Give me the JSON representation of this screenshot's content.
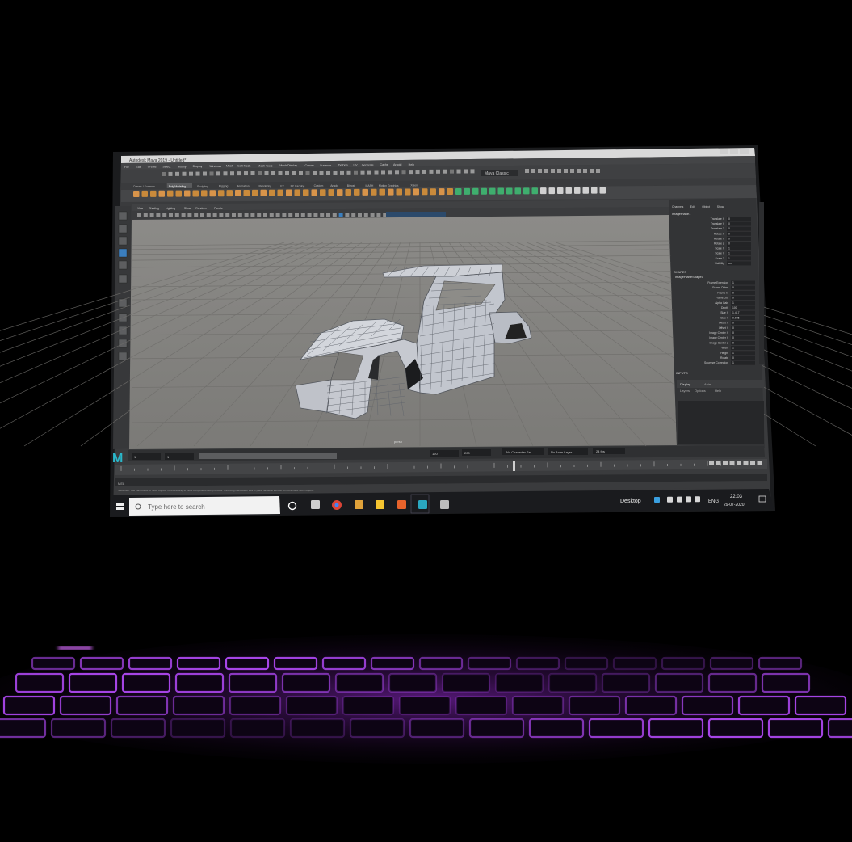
{
  "photo": {
    "description_subject": "laptop-screen-photo"
  },
  "maya": {
    "title": "Autodesk Maya 2019 - Untitled*",
    "menus": [
      "File",
      "Edit",
      "Create",
      "Select",
      "Modify",
      "Display",
      "Windows",
      "Mesh",
      "Edit Mesh",
      "Mesh Tools",
      "Mesh Display",
      "Curves",
      "Surfaces",
      "Deform",
      "UV",
      "Generate",
      "Cache",
      "Arnold",
      "Help"
    ],
    "workspace": "Maya Classic",
    "shelf_tabs": [
      "Curves / Surfaces",
      "Poly Modeling",
      "Sculpting",
      "Rigging",
      "Animation",
      "Rendering",
      "FX",
      "FX Caching",
      "Custom",
      "Arnold",
      "Bifrost",
      "MASH",
      "Motion Graphics",
      "XGen"
    ],
    "active_shelf_tab": "Poly Modeling",
    "panel_menus": [
      "View",
      "Shading",
      "Lighting",
      "Show",
      "Renderer",
      "Panels"
    ],
    "channel_box": {
      "header": [
        "Channels",
        "Edit",
        "Object",
        "Show"
      ],
      "object_name": "imagePlane1",
      "attrs": [
        {
          "name": "Translate X",
          "value": "0"
        },
        {
          "name": "Translate Y",
          "value": "0"
        },
        {
          "name": "Translate Z",
          "value": "0"
        },
        {
          "name": "Rotate X",
          "value": "0"
        },
        {
          "name": "Rotate Y",
          "value": "0"
        },
        {
          "name": "Rotate Z",
          "value": "0"
        },
        {
          "name": "Scale X",
          "value": "1"
        },
        {
          "name": "Scale Y",
          "value": "1"
        },
        {
          "name": "Scale Z",
          "value": "1"
        },
        {
          "name": "Visibility",
          "value": "on"
        }
      ],
      "shapes_label": "SHAPES",
      "shape_name": "imagePlaneShape1",
      "shape_attrs": [
        {
          "name": "Frame Extension",
          "value": "1"
        },
        {
          "name": "Frame Offset",
          "value": "0"
        },
        {
          "name": "Frame In",
          "value": "0"
        },
        {
          "name": "Frame Out",
          "value": "0"
        },
        {
          "name": "Alpha Gain",
          "value": "1"
        },
        {
          "name": "Depth",
          "value": "100"
        },
        {
          "name": "Size X",
          "value": "1.417"
        },
        {
          "name": "Size Y",
          "value": "0.945"
        },
        {
          "name": "Offset X",
          "value": "0"
        },
        {
          "name": "Offset Y",
          "value": "0"
        },
        {
          "name": "Image Center X",
          "value": "0"
        },
        {
          "name": "Image Center Y",
          "value": "0"
        },
        {
          "name": "Image Center Z",
          "value": "0"
        },
        {
          "name": "Width",
          "value": "1"
        },
        {
          "name": "Height",
          "value": "1"
        },
        {
          "name": "Rotate",
          "value": "0"
        },
        {
          "name": "Squeeze Correction",
          "value": "1"
        }
      ],
      "inputs_label": "INPUTS",
      "layer_tabs": [
        "Display",
        "Anim"
      ],
      "layer_menus": [
        "Layers",
        "Options",
        "Help"
      ]
    },
    "timeline": {
      "start": "1",
      "end": "120",
      "range_end": "200",
      "current": "1",
      "character_set": "No Character Set",
      "anim_layer": "No Anim Layer",
      "fps": "24 fps"
    },
    "mel_label": "MEL",
    "help_line": "Show Item: Use manipulator to move objects. Ctrl+LMB-drag to move components along normals. Shift+drag manipulator axis or plane handle to extrude components or clone objects."
  },
  "taskbar": {
    "search_placeholder": "Type here to search",
    "desktop_label": "Desktop",
    "lang": "ENG",
    "time": "22:03",
    "date": "29-07-2020"
  },
  "colors": {
    "viewport": "#8b8a86",
    "maya_ui": "#3b3c3e",
    "shelf_icon": "#c98a3b",
    "keyboard_glow": "#b43cff"
  }
}
